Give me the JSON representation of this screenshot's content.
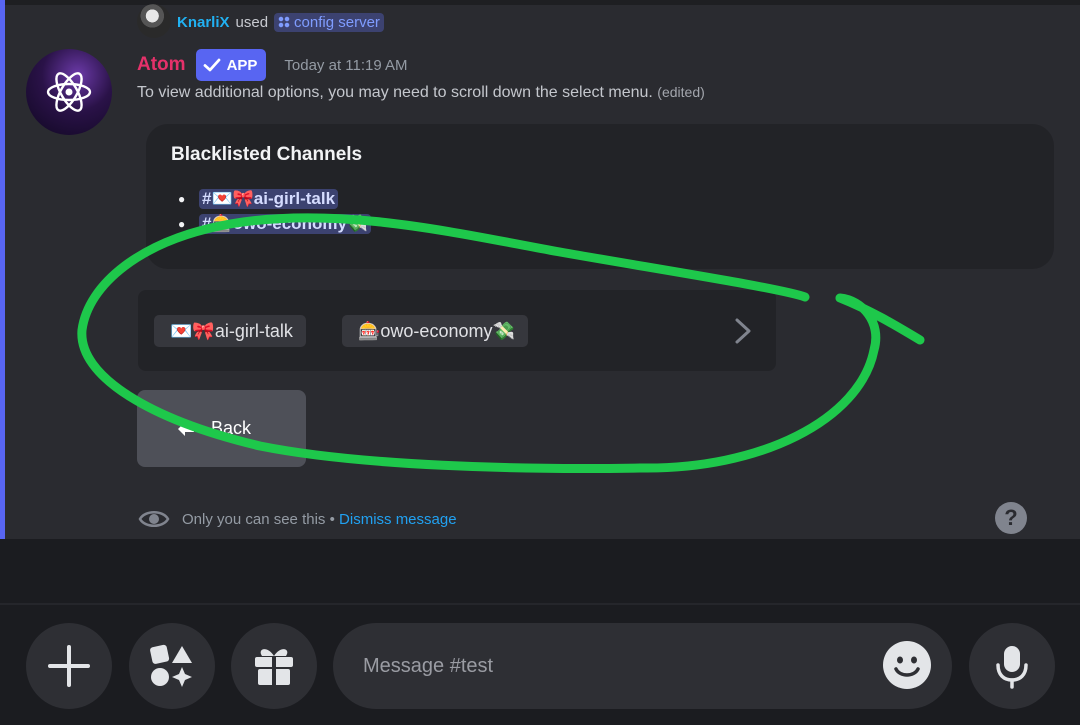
{
  "reply": {
    "user": "KnarliX",
    "used": "used",
    "command": "config server"
  },
  "message": {
    "author": "Atom",
    "badge": "APP",
    "timestamp": "Today at 11:19 AM",
    "text": "To view additional options, you may need to scroll down the select menu.",
    "edited": "(edited)"
  },
  "embed": {
    "title": "Blacklisted Channels",
    "channels": [
      "#💌🎀ai-girl-talk",
      "#🎰owo-economy💸"
    ]
  },
  "select_menu": {
    "options": [
      "💌🎀ai-girl-talk",
      "🎰owo-economy💸"
    ]
  },
  "back_button": {
    "label": "Back"
  },
  "footer": {
    "notice": "Only you can see this",
    "separator": "•",
    "dismiss": "Dismiss message",
    "help": "?"
  },
  "composer": {
    "placeholder": "Message #test"
  },
  "colors": {
    "accent": "#5865f2",
    "author": "#e5316a",
    "link": "#21a1f1",
    "annotation": "#1ec84b"
  },
  "icons": [
    "atom-icon",
    "check-icon",
    "eye-icon",
    "help-icon",
    "chevron-right-icon",
    "plus-icon",
    "apps-icon",
    "gift-icon",
    "emoji-icon",
    "microphone-icon",
    "back-arrow-icon"
  ]
}
